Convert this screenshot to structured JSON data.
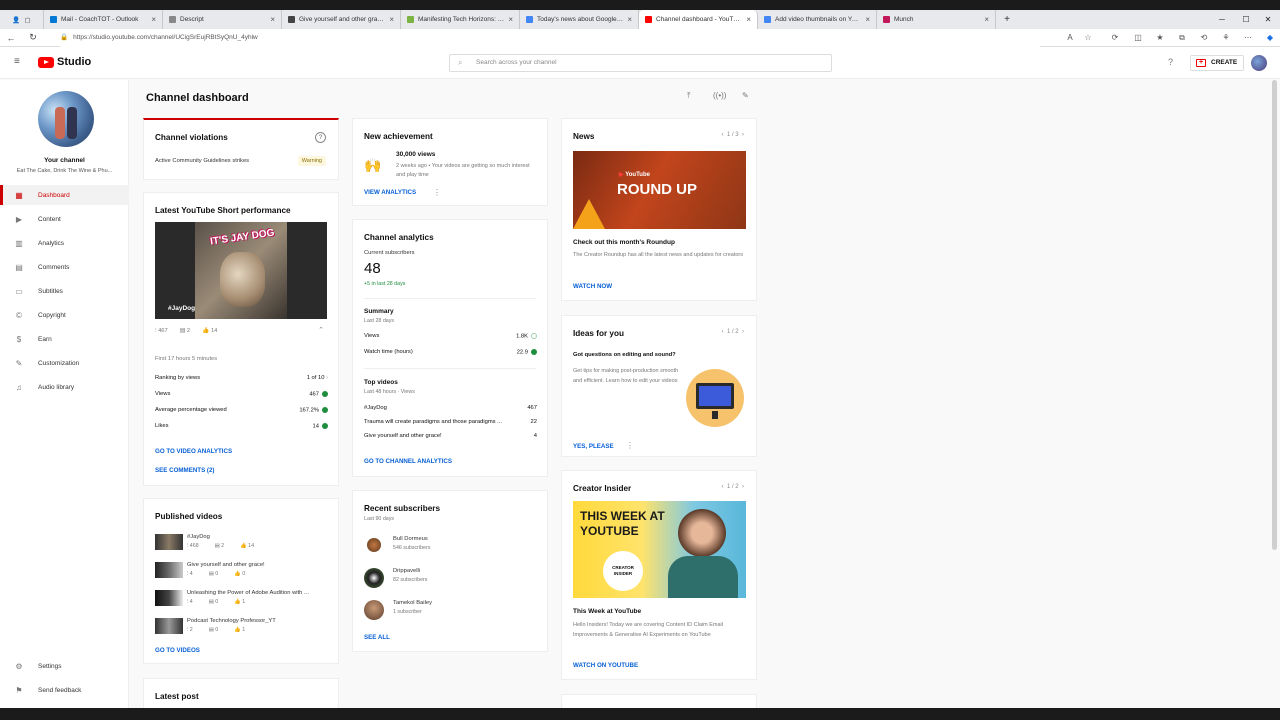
{
  "browser": {
    "tabs": [
      {
        "title": "Mail - CoachTOT - Outlook",
        "color": "#0078d4"
      },
      {
        "title": "Descript",
        "color": "#888888"
      },
      {
        "title": "Give yourself and other grace! -",
        "color": "#444444"
      },
      {
        "title": "Manifesting Tech Horizons: The",
        "color": "#7cb342"
      },
      {
        "title": "Today's news about Google Pod",
        "color": "#4285f4"
      },
      {
        "title": "Channel dashboard - YouTube St",
        "color": "#ff0000",
        "active": true
      },
      {
        "title": "Add video thumbnails on YouTu",
        "color": "#4285f4"
      },
      {
        "title": "Munch",
        "color": "#c2185b"
      }
    ],
    "url": "https://studio.youtube.com/channel/UCigSrEujRBtSyQnU_4yhlw"
  },
  "header": {
    "logo_text": "Studio",
    "search_placeholder": "Search across your channel",
    "create_label": "CREATE"
  },
  "sidebar": {
    "channel_label": "Your channel",
    "channel_name": "Eat The Cake, Drink The Wine & Phu...",
    "items": [
      {
        "label": "Dashboard",
        "icon": "dashboard-icon"
      },
      {
        "label": "Content",
        "icon": "content-icon"
      },
      {
        "label": "Analytics",
        "icon": "analytics-icon"
      },
      {
        "label": "Comments",
        "icon": "comments-icon"
      },
      {
        "label": "Subtitles",
        "icon": "subtitles-icon"
      },
      {
        "label": "Copyright",
        "icon": "copyright-icon"
      },
      {
        "label": "Earn",
        "icon": "earn-icon"
      },
      {
        "label": "Customization",
        "icon": "customization-icon"
      },
      {
        "label": "Audio library",
        "icon": "audio-library-icon"
      }
    ],
    "settings_label": "Settings",
    "feedback_label": "Send feedback"
  },
  "main": {
    "title": "Channel dashboard",
    "violations": {
      "title": "Channel violations",
      "item": "Active Community Guidelines strikes",
      "badge": "Warning"
    },
    "short_perf": {
      "title": "Latest YouTube Short performance",
      "thumb_text": "IT'S JAY DOG",
      "thumb_tag": "#JayDog",
      "views": "467",
      "comments": "2",
      "likes": "14",
      "period": "First 17 hours 5 minutes",
      "rows": [
        {
          "label": "Ranking by views",
          "value": "1 of 10"
        },
        {
          "label": "Views",
          "value": "467"
        },
        {
          "label": "Average percentage viewed",
          "value": "167.2%"
        },
        {
          "label": "Likes",
          "value": "14"
        }
      ],
      "link1": "GO TO VIDEO ANALYTICS",
      "link2": "SEE COMMENTS (2)"
    },
    "published": {
      "title": "Published videos",
      "items": [
        {
          "title": "#JayDog",
          "views": "468",
          "comments": "2",
          "likes": "14"
        },
        {
          "title": "Give yourself and other grace!",
          "views": "4",
          "comments": "0",
          "likes": "0"
        },
        {
          "title": "Unleashing the Power of Adobe Audition with ...",
          "views": "4",
          "comments": "0",
          "likes": "1"
        },
        {
          "title": "Podcast Technology Professor_YT",
          "views": "2",
          "comments": "0",
          "likes": "1"
        }
      ],
      "link": "GO TO VIDEOS"
    },
    "latest_post": {
      "title": "Latest post"
    },
    "achievement": {
      "title": "New achievement",
      "headline": "30,000 views",
      "desc": "2 weeks ago • Your videos are getting so much interest and play time",
      "link": "VIEW ANALYTICS"
    },
    "analytics": {
      "title": "Channel analytics",
      "subs_label": "Current subscribers",
      "subs_value": "48",
      "subs_change": "+5 in last 28 days",
      "summary_title": "Summary",
      "summary_period": "Last 28 days",
      "summary_rows": [
        {
          "label": "Views",
          "value": "1.8K"
        },
        {
          "label": "Watch time (hours)",
          "value": "22.9"
        }
      ],
      "top_title": "Top videos",
      "top_period": "Last 48 hours · Views",
      "top_rows": [
        {
          "label": "#JayDog",
          "value": "467"
        },
        {
          "label": "Trauma will create paradigms and those paradigms ...",
          "value": "22"
        },
        {
          "label": "Give yourself and other grace!",
          "value": "4"
        }
      ],
      "link": "GO TO CHANNEL ANALYTICS"
    },
    "recent_subs": {
      "title": "Recent subscribers",
      "period": "Last 90 days",
      "items": [
        {
          "name": "Bull Dormeus",
          "subs": "546 subscribers"
        },
        {
          "name": "Drippavelli",
          "subs": "82 subscribers"
        },
        {
          "name": "Tamekol Bailey",
          "subs": "1 subscriber"
        }
      ],
      "link": "SEE ALL"
    },
    "news": {
      "title": "News",
      "pager": "1 / 3",
      "img_brand": "YouTube",
      "img_text": "ROUND UP",
      "headline": "Check out this month's Roundup",
      "desc": "The Creator Roundup has all the latest news and updates for creators",
      "link": "WATCH NOW"
    },
    "ideas": {
      "title": "Ideas for you",
      "pager": "1 / 2",
      "headline": "Got questions on editing and sound?",
      "desc": "Get tips for making post-production smooth and efficient. Learn how to edit your videos",
      "link": "YES, PLEASE"
    },
    "insider": {
      "title": "Creator Insider",
      "pager": "1 / 2",
      "img_text": "THIS WEEK AT YOUTUBE",
      "img_badge": "CREATOR INSIDER",
      "headline": "This Week at YouTube",
      "desc": "Hello Insiders! Today we are covering Content ID Claim Email Improvements & Generative AI Experiments on YouTube",
      "link": "WATCH ON YOUTUBE"
    }
  },
  "colors": {
    "accent_red": "#cc0000",
    "link_blue": "#065fd4",
    "good_green": "#1e8e3e"
  }
}
